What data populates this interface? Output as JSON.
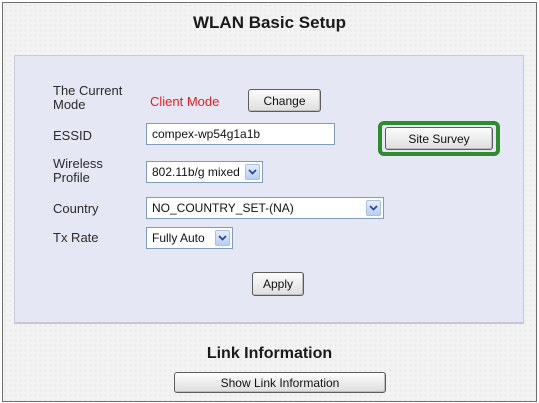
{
  "page": {
    "title": "WLAN Basic Setup"
  },
  "form": {
    "mode_label": "The Current Mode",
    "mode_value": "Client Mode",
    "change_button": "Change",
    "essid_label": "ESSID",
    "essid_value": "compex-wp54g1a1b",
    "site_survey_button": "Site Survey",
    "profile_label": "Wireless Profile",
    "profile_value": "802.11b/g mixed",
    "country_label": "Country",
    "country_value": "NO_COUNTRY_SET-(NA)",
    "txrate_label": "Tx Rate",
    "txrate_value": "Fully Auto",
    "apply_button": "Apply"
  },
  "link_info": {
    "title": "Link Information",
    "button": "Show Link Information"
  },
  "colors": {
    "mode_value": "#e02020",
    "highlight": "#2e8b2e",
    "panel": "#e6e7f5"
  },
  "icons": {
    "dropdown": "chevron-down-icon"
  }
}
